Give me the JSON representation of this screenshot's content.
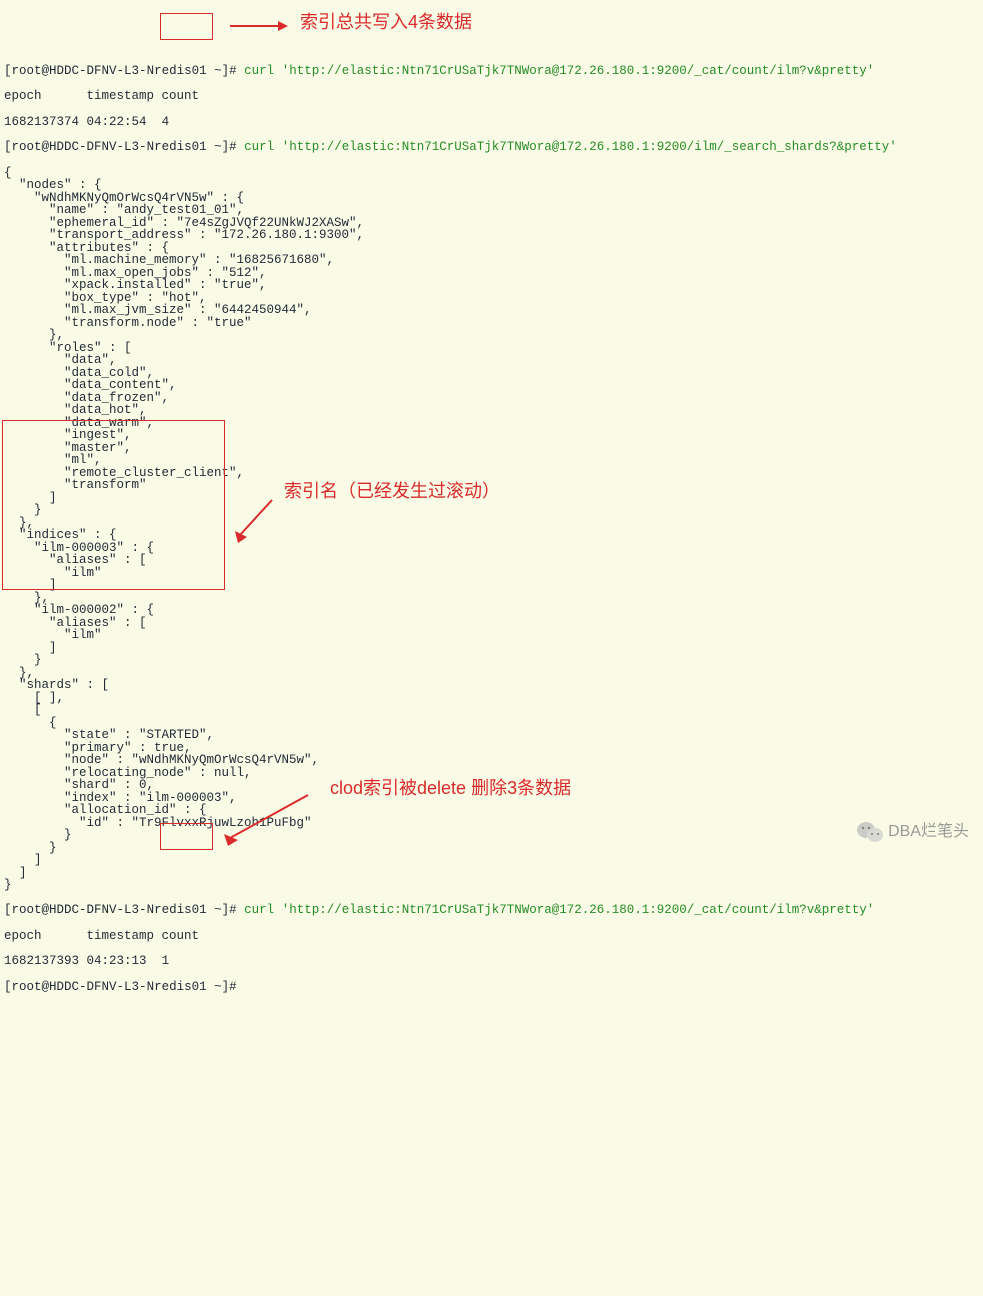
{
  "prompt": {
    "user": "root",
    "host": "HDDC-DFNV-L3-Nredis01",
    "dir": "~",
    "symbol": "#"
  },
  "cmd1": {
    "curl": "curl",
    "url": "'http://elastic:Ntn71CrUSaTjk7TNWora@172.26.180.1:9200/_cat/count/ilm?v&pretty'"
  },
  "count1": {
    "header": "epoch      timestamp count",
    "epoch": "1682137374",
    "time": "04:22:54",
    "count": "4"
  },
  "cmd2": {
    "curl": "curl",
    "url": "'http://elastic:Ntn71CrUSaTjk7TNWora@172.26.180.1:9200/ilm/_search_shards?&pretty'"
  },
  "json_output": "{\n  \"nodes\" : {\n    \"wNdhMKNyQmOrWcsQ4rVN5w\" : {\n      \"name\" : \"andy_test01_01\",\n      \"ephemeral_id\" : \"7e4sZgJVQf22UNkWJ2XASw\",\n      \"transport_address\" : \"172.26.180.1:9300\",\n      \"attributes\" : {\n        \"ml.machine_memory\" : \"16825671680\",\n        \"ml.max_open_jobs\" : \"512\",\n        \"xpack.installed\" : \"true\",\n        \"box_type\" : \"hot\",\n        \"ml.max_jvm_size\" : \"6442450944\",\n        \"transform.node\" : \"true\"\n      },\n      \"roles\" : [\n        \"data\",\n        \"data_cold\",\n        \"data_content\",\n        \"data_frozen\",\n        \"data_hot\",\n        \"data_warm\",\n        \"ingest\",\n        \"master\",\n        \"ml\",\n        \"remote_cluster_client\",\n        \"transform\"\n      ]\n    }\n  },\n  \"indices\" : {\n    \"ilm-000003\" : {\n      \"aliases\" : [\n        \"ilm\"\n      ]\n    },\n    \"ilm-000002\" : {\n      \"aliases\" : [\n        \"ilm\"\n      ]\n    }\n  },\n  \"shards\" : [\n    [ ],\n    [\n      {\n        \"state\" : \"STARTED\",\n        \"primary\" : true,\n        \"node\" : \"wNdhMKNyQmOrWcsQ4rVN5w\",\n        \"relocating_node\" : null,\n        \"shard\" : 0,\n        \"index\" : \"ilm-000003\",\n        \"allocation_id\" : {\n          \"id\" : \"Tr9FlvxxRjuwLzoh1PuFbg\"\n        }\n      }\n    ]\n  ]\n}",
  "cmd3": {
    "curl": "curl",
    "url": "'http://elastic:Ntn71CrUSaTjk7TNWora@172.26.180.1:9200/_cat/count/ilm?v&pretty'"
  },
  "count2": {
    "header": "epoch      timestamp count",
    "epoch": "1682137393",
    "time": "04:23:13",
    "count": "1"
  },
  "annotations": {
    "a1": "索引总共写入4条数据",
    "a2": "索引名（已经发生过滚动）",
    "a3": "clod索引被delete 删除3条数据"
  },
  "watermark": "DBA烂笔头"
}
